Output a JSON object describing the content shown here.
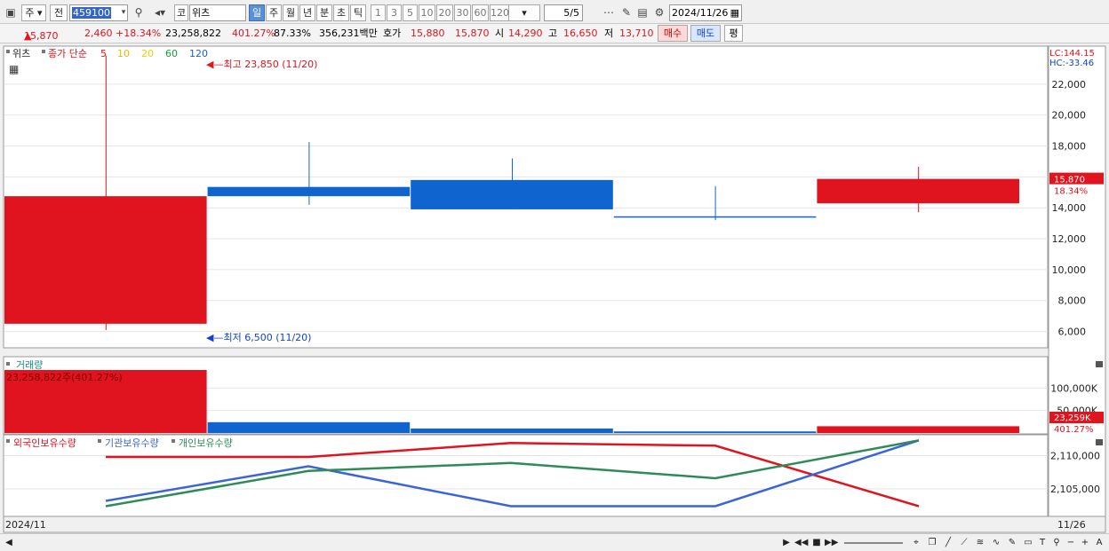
{
  "toolbar": {
    "market": "주",
    "scope": "전",
    "code": "459100",
    "name": "위츠",
    "kor": "코",
    "periods": [
      "일",
      "주",
      "월",
      "년",
      "분",
      "초",
      "틱"
    ],
    "intervals": [
      "1",
      "3",
      "5",
      "10",
      "20",
      "30",
      "60",
      "120"
    ],
    "count": "5",
    "count_total": "5",
    "date": "2024/11/26"
  },
  "quote": {
    "price": "15,870",
    "change": "2,460",
    "change_pct": "+18.34%",
    "volume": "23,258,822",
    "vol_ratio": "401.27%",
    "turnover_rate": "87.33%",
    "amount": "356,231백만",
    "bid_label": "호가",
    "ask": "15,880",
    "bid": "15,870",
    "open_label": "시",
    "open": "14,290",
    "high_label": "고",
    "high": "16,650",
    "low_label": "저",
    "low": "13,710",
    "buy_label": "매수",
    "sell_label": "매도",
    "avg_label": "평"
  },
  "price_panel": {
    "name_label": "위츠",
    "ma_label": "종가 단순",
    "ma_periods": [
      "5",
      "10",
      "20",
      "60",
      "120"
    ],
    "ma_colors": [
      "#e0141e",
      "#f0b400",
      "#e8d200",
      "#1a9a3a",
      "#1a60c8"
    ],
    "lc": "LC:144.15",
    "hc": "HC:-33.46",
    "max_label": "최고 23,850 (11/20)",
    "min_label": "최저 6,500 (11/20)",
    "cur_price": "15,870",
    "cur_pct": "18.34%"
  },
  "volume_panel": {
    "title": "거래량",
    "readout": "23,258,822주(401.27%)",
    "cur": "23,259K",
    "cur_pct": "401.27%"
  },
  "holdings_panel": {
    "series": [
      "외국인보유수량",
      "기관보유수량",
      "개인보유수량"
    ],
    "colors": [
      "#e0141e",
      "#3a64d8",
      "#2e8b57"
    ]
  },
  "xaxis": {
    "start": "2024/11",
    "end": "11/26"
  },
  "chart_data": [
    {
      "type": "candlestick",
      "ylim": [
        5000,
        24400
      ],
      "yticks": [
        6000,
        8000,
        10000,
        12000,
        14000,
        16000,
        18000,
        20000,
        22000
      ],
      "ytick_labels": [
        "6,000",
        "8,000",
        "10,000",
        "12,000",
        "14,000",
        "16,000",
        "18,000",
        "20,000",
        "22,000"
      ],
      "candles": [
        {
          "open": 6500,
          "close": 14750,
          "high": 23850,
          "low": 6100,
          "color": "#e0141e"
        },
        {
          "open": 15350,
          "close": 14750,
          "high": 18250,
          "low": 14200,
          "color": "#1064d0"
        },
        {
          "open": 15800,
          "close": 13900,
          "high": 17200,
          "low": 13900,
          "color": "#1064d0"
        },
        {
          "open": 13450,
          "close": 13400,
          "high": 15400,
          "low": 13200,
          "color": "#1064d0"
        },
        {
          "open": 14290,
          "close": 15870,
          "high": 16650,
          "low": 13710,
          "color": "#e0141e"
        }
      ]
    },
    {
      "type": "bar",
      "ylim": [
        0,
        140000
      ],
      "yticks": [
        50000,
        100000
      ],
      "ytick_labels": [
        "50,000K",
        "100,000K"
      ],
      "values": [
        140000,
        24000,
        10000,
        3500,
        15000
      ],
      "colors": [
        "#e0141e",
        "#1064d0",
        "#1064d0",
        "#1064d0",
        "#e0141e"
      ]
    },
    {
      "type": "line",
      "ylim": [
        2101000,
        2113000
      ],
      "yticks": [
        2105000,
        2110000
      ],
      "ytick_labels": [
        "2,105,000",
        "2,110,000"
      ],
      "series": [
        {
          "name": "외국인보유수량",
          "values": [
            2109800,
            2109800,
            2111900,
            2111500,
            2102400
          ]
        },
        {
          "name": "기관보유수량",
          "values": [
            2103200,
            2108400,
            2102400,
            2102400,
            2112300
          ]
        },
        {
          "name": "개인보유수량",
          "values": [
            2102400,
            2107700,
            2108900,
            2106600,
            2112300
          ]
        }
      ]
    }
  ]
}
